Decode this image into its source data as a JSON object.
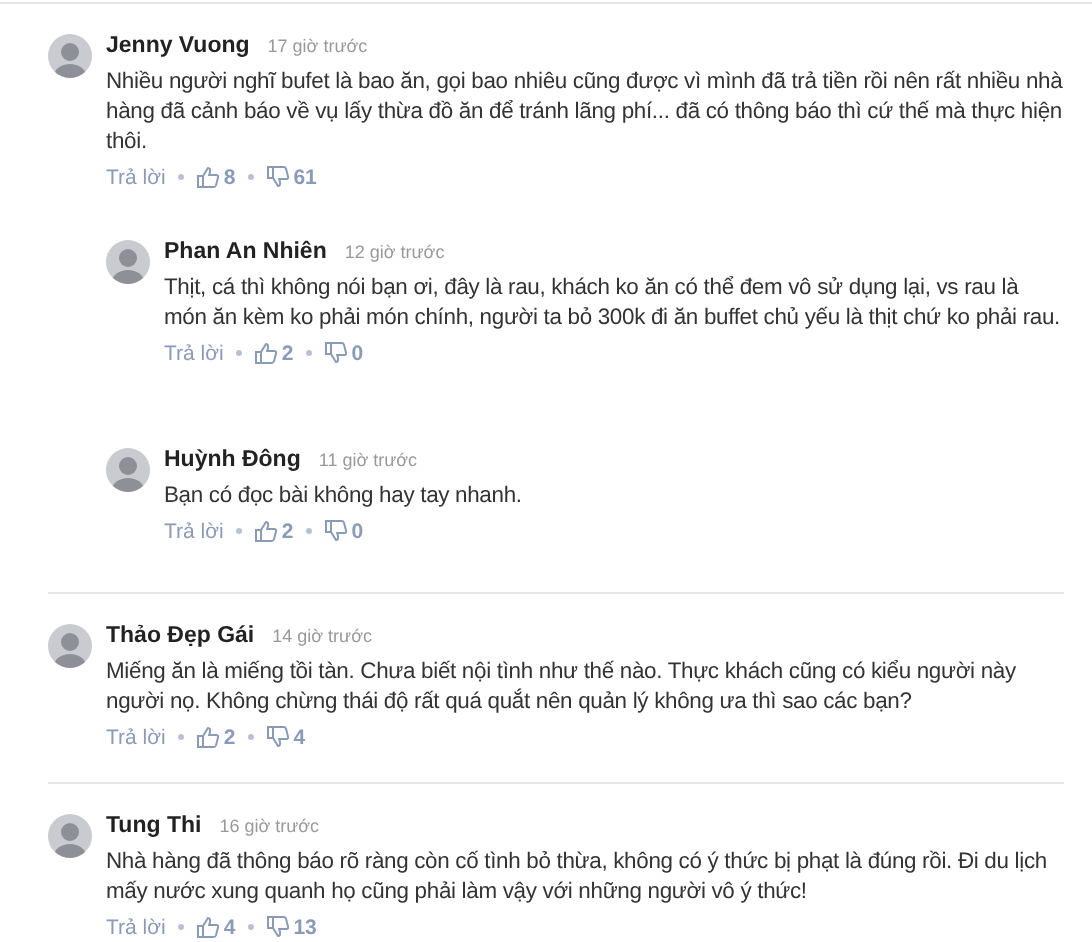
{
  "comments": [
    {
      "author": "Jenny Vuong",
      "time": "17 giờ trước",
      "text": "Nhiều người nghĩ bufet là bao ăn, gọi bao nhiêu cũng được vì mình đã trả tiền rồi nên rất nhiều nhà hàng đã cảnh báo về vụ lấy thừa đồ ăn để tránh lãng phí... đã có thông báo thì cứ thế mà thực hiện thôi.",
      "reply": "Trả lời",
      "likes": "8",
      "dislikes": "61",
      "replies": [
        {
          "author": "Phan An Nhiên",
          "time": "12 giờ trước",
          "text": "Thịt, cá thì không nói bạn ơi, đây là rau, khách ko ăn có thể đem vô sử dụng lại, vs rau là món ăn kèm ko phải món chính, người ta bỏ 300k đi ăn buffet chủ yếu là thịt chứ ko phải rau.",
          "reply": "Trả lời",
          "likes": "2",
          "dislikes": "0"
        },
        {
          "author": "Huỳnh Đông",
          "time": "11 giờ trước",
          "text": "Bạn có đọc bài không hay tay nhanh.",
          "reply": "Trả lời",
          "likes": "2",
          "dislikes": "0"
        }
      ]
    },
    {
      "author": "Thảo Đẹp Gái",
      "time": "14 giờ trước",
      "text": "Miếng ăn là miếng tồi tàn. Chưa biết nội tình như thế nào. Thực khách cũng có kiểu người này người nọ. Không chừng thái độ rất quá quắt nên quản lý không ưa thì sao các bạn?",
      "reply": "Trả lời",
      "likes": "2",
      "dislikes": "4"
    },
    {
      "author": "Tung Thi",
      "time": "16 giờ trước",
      "text": "Nhà hàng đã thông báo rõ ràng còn cố tình bỏ thừa, không có ý thức bị phạt là đúng rồi. Đi du lịch mấy nước xung quanh họ cũng phải làm vậy với những người vô ý thức!",
      "reply": "Trả lời",
      "likes": "4",
      "dislikes": "13"
    }
  ]
}
